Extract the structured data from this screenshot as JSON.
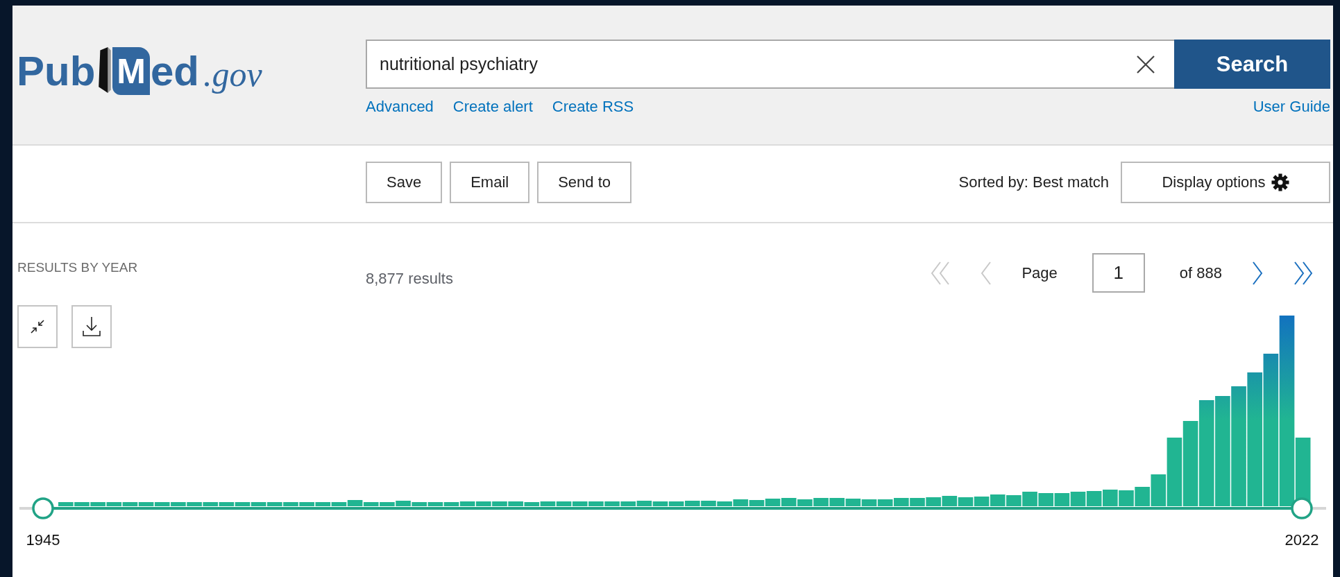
{
  "logo": {
    "left": "Pub",
    "mark": "M",
    "right": "ed",
    "suffix": ".gov"
  },
  "search": {
    "value": "nutritional psychiatry",
    "button": "Search"
  },
  "search_links": [
    {
      "label": "Advanced"
    },
    {
      "label": "Create alert"
    },
    {
      "label": "Create RSS"
    }
  ],
  "user_guide": "User Guide",
  "actions": [
    "Save",
    "Email",
    "Send to"
  ],
  "sort": "Sorted by: Best match",
  "display_options": "Display options",
  "results_by_year": {
    "title": "RESULTS BY YEAR",
    "start_year": "1945",
    "end_year": "2022"
  },
  "results_count": "8,877 results",
  "pagination": {
    "first": {
      "disabled": true
    },
    "previous": {
      "disabled": true
    },
    "label": "Page",
    "page": "1",
    "of": "of 888",
    "next": {
      "disabled": false
    },
    "last": {
      "disabled": false
    }
  }
}
